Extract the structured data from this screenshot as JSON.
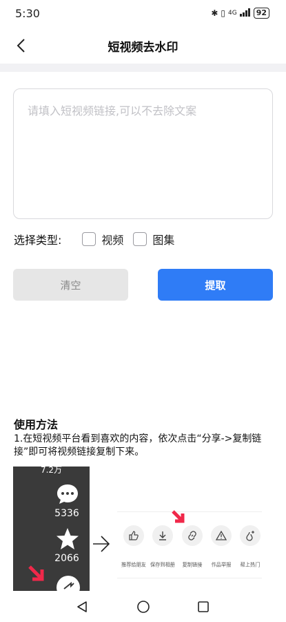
{
  "status_bar": {
    "time": "5:30",
    "network": "4G",
    "battery": "92"
  },
  "header": {
    "title": "短视频去水印"
  },
  "form": {
    "link_placeholder": "请填入短视频链接,可以不去除文案",
    "link_value": "",
    "type_label": "选择类型:",
    "options": [
      {
        "label": "视频",
        "checked": false
      },
      {
        "label": "图集",
        "checked": false
      }
    ],
    "clear_label": "清空",
    "extract_label": "提取"
  },
  "usage": {
    "title": "使用方法",
    "step1": "1.在短视频平台看到喜欢的内容，依次点击“分享->复制链接”即可将视频链接复制下来。",
    "demo": {
      "top_count": "7.2万",
      "comment_count": "5336",
      "favorite_count": "2066",
      "share_items": [
        {
          "label": "推荐给朋友",
          "icon": "thumb-up-icon"
        },
        {
          "label": "保存到相册",
          "icon": "download-icon"
        },
        {
          "label": "复制链接",
          "icon": "link-icon"
        },
        {
          "label": "作品举报",
          "icon": "warning-icon"
        },
        {
          "label": "帮上热门",
          "icon": "flame-icon"
        }
      ],
      "highlight_color": "#f0284a"
    }
  },
  "colors": {
    "primary": "#2f7cf6",
    "clear_bg": "#e6e6e6",
    "divider": "#f1f1f4"
  }
}
